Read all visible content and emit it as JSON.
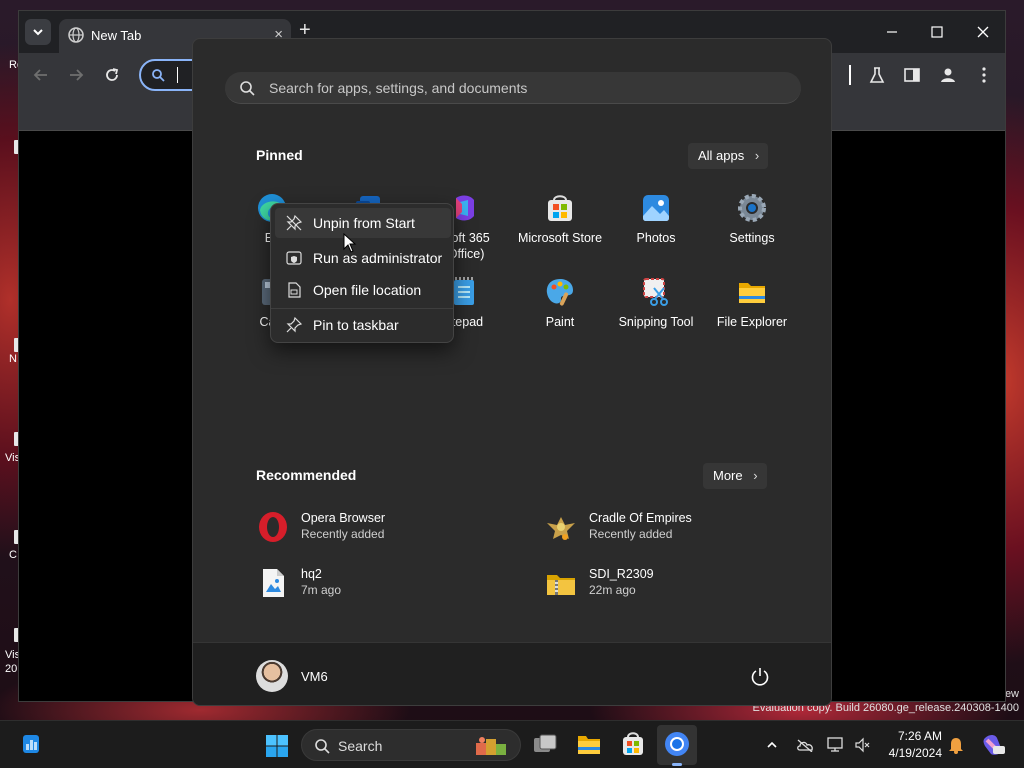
{
  "desktop": {
    "left_labels": [
      "Re",
      "N",
      "Vis",
      "C",
      "Vis",
      "20"
    ],
    "right_label": "ew",
    "watermark": "Evaluation copy. Build 26080.ge_release.240308-1400"
  },
  "browser": {
    "tab": {
      "title": "New Tab",
      "close_label": "×"
    },
    "new_tab_label": "+",
    "icons": [
      "globe-icon",
      "back-icon",
      "forward-icon",
      "reload-icon",
      "labs-icon",
      "side-panel-icon",
      "profile-icon",
      "menu-icon"
    ]
  },
  "start_menu": {
    "search_placeholder": "Search for apps, settings, and documents",
    "pinned_title": "Pinned",
    "all_apps_label": "All apps",
    "chevron": "›",
    "pinned": [
      {
        "label": "Ec",
        "icon": "edge-icon"
      },
      {
        "label": "",
        "icon": "outlook-icon"
      },
      {
        "label": "osoft 365\n(Office)",
        "icon": "microsoft-365-icon"
      },
      {
        "label": "Microsoft Store",
        "icon": "store-icon"
      },
      {
        "label": "Photos",
        "icon": "photos-icon"
      },
      {
        "label": "Settings",
        "icon": "settings-icon"
      },
      {
        "label": "Calc",
        "icon": "calculator-icon"
      },
      {
        "label": "",
        "icon": "calendar-icon"
      },
      {
        "label": "otepad",
        "icon": "notepad-icon"
      },
      {
        "label": "Paint",
        "icon": "paint-icon"
      },
      {
        "label": "Snipping Tool",
        "icon": "snipping-tool-icon"
      },
      {
        "label": "File Explorer",
        "icon": "file-explorer-icon"
      }
    ],
    "recommended_title": "Recommended",
    "more_label": "More",
    "recommended": [
      {
        "name": "Opera Browser",
        "sub": "Recently added",
        "icon": "opera-icon"
      },
      {
        "name": "Cradle Of Empires",
        "sub": "Recently added",
        "icon": "cradle-of-empires-icon"
      },
      {
        "name": "hq2",
        "sub": "7m ago",
        "icon": "image-file-icon"
      },
      {
        "name": "SDI_R2309",
        "sub": "22m ago",
        "icon": "zip-folder-icon"
      }
    ],
    "user": {
      "name": "VM6"
    }
  },
  "context_menu": {
    "items": [
      {
        "label": "Unpin from Start",
        "icon": "unpin-icon"
      },
      {
        "label": "Run as administrator",
        "icon": "shield-icon"
      },
      {
        "label": "Open file location",
        "icon": "folder-location-icon"
      },
      {
        "label": "Pin to taskbar",
        "icon": "pin-icon"
      }
    ]
  },
  "taskbar": {
    "search_label": "Search",
    "clock_time": "7:26 AM",
    "clock_date": "4/19/2024",
    "apps": [
      "task-view-icon",
      "file-explorer-icon",
      "store-icon",
      "chrome-icon"
    ],
    "tray": [
      "chevron-up-icon",
      "onedrive-icon",
      "network-icon",
      "volume-icon",
      "notification-bell-icon",
      "copilot-icon"
    ]
  },
  "colors": {
    "start_bg": "#2b2b2b",
    "accent": "#8ab4f8",
    "taskbar_bg": "#1c1c1c"
  }
}
